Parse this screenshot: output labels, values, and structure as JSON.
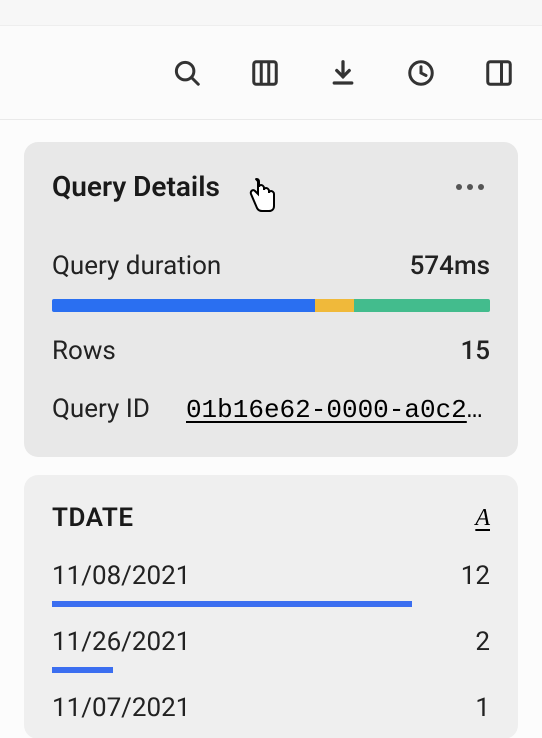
{
  "toolbar": {
    "icons": [
      "search",
      "columns",
      "download",
      "history",
      "panel-right"
    ]
  },
  "details": {
    "title": "Query Details",
    "duration_label": "Query duration",
    "duration_value": "574ms",
    "segments_pct": {
      "blue": 60,
      "yellow": 9,
      "green": 31
    },
    "rows_label": "Rows",
    "rows_value": "15",
    "qid_label": "Query ID",
    "qid_value": "01b16e62-0000-a0c2-..."
  },
  "column": {
    "name": "TDATE",
    "sort_indicator": "A",
    "distribution": [
      {
        "label": "11/08/2021",
        "count": 12,
        "bar_pct": 100
      },
      {
        "label": "11/26/2021",
        "count": 2,
        "bar_pct": 17
      },
      {
        "label": "11/07/2021",
        "count": 1,
        "bar_pct": 0
      }
    ]
  }
}
